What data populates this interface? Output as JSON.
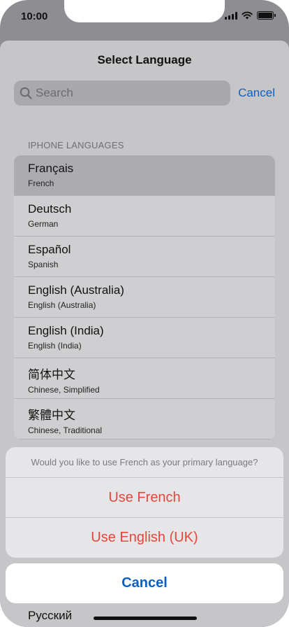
{
  "status_bar": {
    "time": "10:00"
  },
  "sheet": {
    "title": "Select Language",
    "search": {
      "placeholder": "Search",
      "value": ""
    },
    "search_cancel": "Cancel",
    "section_header": "IPHONE LANGUAGES",
    "languages": [
      {
        "native": "Français",
        "english": "French",
        "selected": true
      },
      {
        "native": "Deutsch",
        "english": "German"
      },
      {
        "native": "Español",
        "english": "Spanish"
      },
      {
        "native": "English (Australia)",
        "english": "English (Australia)"
      },
      {
        "native": "English (India)",
        "english": "English (India)"
      },
      {
        "native": "简体中文",
        "english": "Chinese, Simplified"
      },
      {
        "native": "繁體中文",
        "english": "Chinese, Traditional"
      }
    ],
    "partially_visible_language": "Русский"
  },
  "action_sheet": {
    "message": "Would you like to use French as your primary language?",
    "options": [
      "Use French",
      "Use English (UK)"
    ],
    "cancel": "Cancel"
  },
  "colors": {
    "accent": "#0a60c0",
    "destructive": "#e5453a"
  }
}
